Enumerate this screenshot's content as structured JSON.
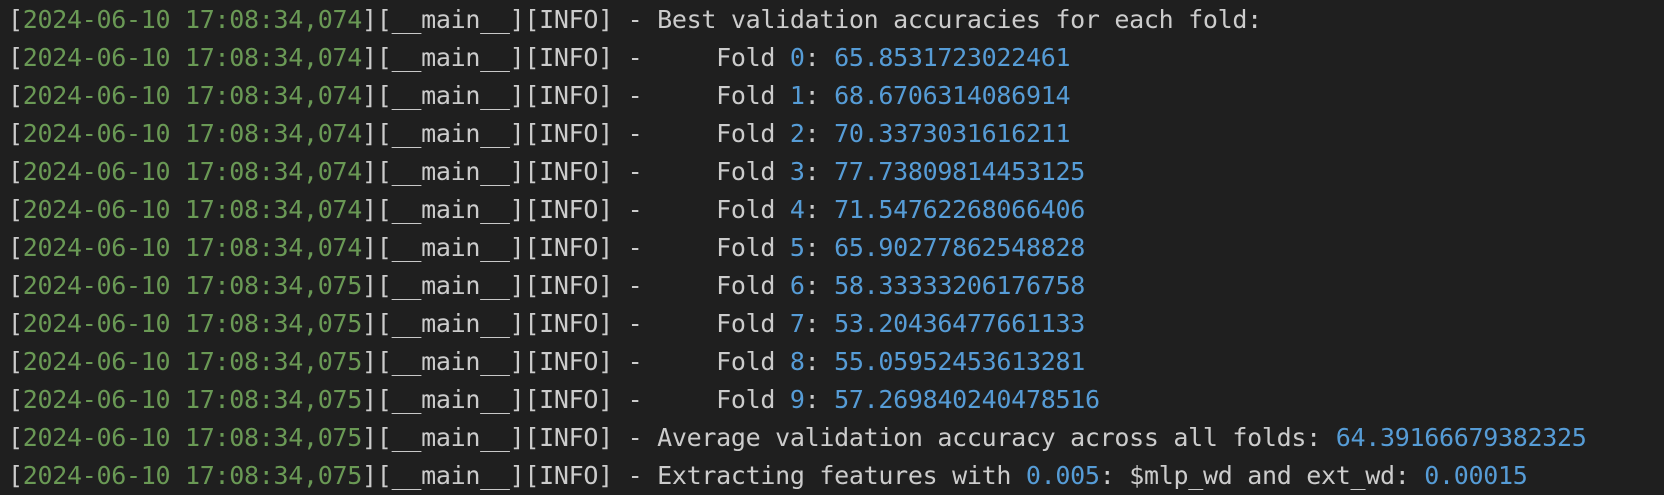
{
  "colors": {
    "background": "#1f1f1f",
    "text": "#cccccc",
    "timestamp": "#6a9955",
    "number": "#569cd6"
  },
  "lines": [
    {
      "timestamp": "2024-06-10 17:08:34,074",
      "module": "__main__",
      "level": "INFO",
      "segments": [
        {
          "t": " - Best validation accuracies for each fold:",
          "c": "txt"
        }
      ]
    },
    {
      "timestamp": "2024-06-10 17:08:34,074",
      "module": "__main__",
      "level": "INFO",
      "segments": [
        {
          "t": " -     Fold ",
          "c": "txt"
        },
        {
          "t": "0",
          "c": "num"
        },
        {
          "t": ": ",
          "c": "txt"
        },
        {
          "t": "65.8531723022461",
          "c": "num"
        }
      ]
    },
    {
      "timestamp": "2024-06-10 17:08:34,074",
      "module": "__main__",
      "level": "INFO",
      "segments": [
        {
          "t": " -     Fold ",
          "c": "txt"
        },
        {
          "t": "1",
          "c": "num"
        },
        {
          "t": ": ",
          "c": "txt"
        },
        {
          "t": "68.6706314086914",
          "c": "num"
        }
      ]
    },
    {
      "timestamp": "2024-06-10 17:08:34,074",
      "module": "__main__",
      "level": "INFO",
      "segments": [
        {
          "t": " -     Fold ",
          "c": "txt"
        },
        {
          "t": "2",
          "c": "num"
        },
        {
          "t": ": ",
          "c": "txt"
        },
        {
          "t": "70.3373031616211",
          "c": "num"
        }
      ]
    },
    {
      "timestamp": "2024-06-10 17:08:34,074",
      "module": "__main__",
      "level": "INFO",
      "segments": [
        {
          "t": " -     Fold ",
          "c": "txt"
        },
        {
          "t": "3",
          "c": "num"
        },
        {
          "t": ": ",
          "c": "txt"
        },
        {
          "t": "77.73809814453125",
          "c": "num"
        }
      ]
    },
    {
      "timestamp": "2024-06-10 17:08:34,074",
      "module": "__main__",
      "level": "INFO",
      "segments": [
        {
          "t": " -     Fold ",
          "c": "txt"
        },
        {
          "t": "4",
          "c": "num"
        },
        {
          "t": ": ",
          "c": "txt"
        },
        {
          "t": "71.54762268066406",
          "c": "num"
        }
      ]
    },
    {
      "timestamp": "2024-06-10 17:08:34,074",
      "module": "__main__",
      "level": "INFO",
      "segments": [
        {
          "t": " -     Fold ",
          "c": "txt"
        },
        {
          "t": "5",
          "c": "num"
        },
        {
          "t": ": ",
          "c": "txt"
        },
        {
          "t": "65.90277862548828",
          "c": "num"
        }
      ]
    },
    {
      "timestamp": "2024-06-10 17:08:34,075",
      "module": "__main__",
      "level": "INFO",
      "segments": [
        {
          "t": " -     Fold ",
          "c": "txt"
        },
        {
          "t": "6",
          "c": "num"
        },
        {
          "t": ": ",
          "c": "txt"
        },
        {
          "t": "58.33333206176758",
          "c": "num"
        }
      ]
    },
    {
      "timestamp": "2024-06-10 17:08:34,075",
      "module": "__main__",
      "level": "INFO",
      "segments": [
        {
          "t": " -     Fold ",
          "c": "txt"
        },
        {
          "t": "7",
          "c": "num"
        },
        {
          "t": ": ",
          "c": "txt"
        },
        {
          "t": "53.20436477661133",
          "c": "num"
        }
      ]
    },
    {
      "timestamp": "2024-06-10 17:08:34,075",
      "module": "__main__",
      "level": "INFO",
      "segments": [
        {
          "t": " -     Fold ",
          "c": "txt"
        },
        {
          "t": "8",
          "c": "num"
        },
        {
          "t": ": ",
          "c": "txt"
        },
        {
          "t": "55.05952453613281",
          "c": "num"
        }
      ]
    },
    {
      "timestamp": "2024-06-10 17:08:34,075",
      "module": "__main__",
      "level": "INFO",
      "segments": [
        {
          "t": " -     Fold ",
          "c": "txt"
        },
        {
          "t": "9",
          "c": "num"
        },
        {
          "t": ": ",
          "c": "txt"
        },
        {
          "t": "57.269840240478516",
          "c": "num"
        }
      ]
    },
    {
      "timestamp": "2024-06-10 17:08:34,075",
      "module": "__main__",
      "level": "INFO",
      "segments": [
        {
          "t": " - Average validation accuracy across all folds: ",
          "c": "txt"
        },
        {
          "t": "64.39166679382325",
          "c": "num"
        }
      ]
    },
    {
      "timestamp": "2024-06-10 17:08:34,075",
      "module": "__main__",
      "level": "INFO",
      "segments": [
        {
          "t": " - Extracting features with ",
          "c": "txt"
        },
        {
          "t": "0.005",
          "c": "num"
        },
        {
          "t": ": $mlp_wd and ext_wd: ",
          "c": "txt"
        },
        {
          "t": "0.00015",
          "c": "num"
        }
      ]
    }
  ]
}
